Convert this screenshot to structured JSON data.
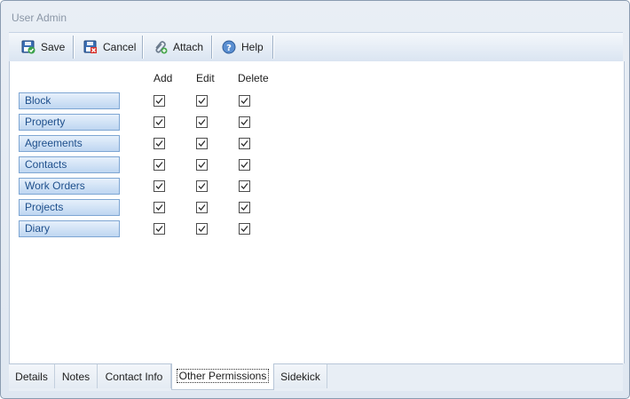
{
  "window": {
    "title": "User Admin"
  },
  "toolbar": {
    "save_label": "Save",
    "cancel_label": "Cancel",
    "attach_label": "Attach",
    "help_label": "Help"
  },
  "permissions": {
    "columns": [
      "Add",
      "Edit",
      "Delete"
    ],
    "rows": [
      {
        "label": "Block",
        "add": true,
        "edit": true,
        "delete": true
      },
      {
        "label": "Property",
        "add": true,
        "edit": true,
        "delete": true
      },
      {
        "label": "Agreements",
        "add": true,
        "edit": true,
        "delete": true
      },
      {
        "label": "Contacts",
        "add": true,
        "edit": true,
        "delete": true
      },
      {
        "label": "Work Orders",
        "add": true,
        "edit": true,
        "delete": true
      },
      {
        "label": "Projects",
        "add": true,
        "edit": true,
        "delete": true
      },
      {
        "label": "Diary",
        "add": true,
        "edit": true,
        "delete": true
      }
    ]
  },
  "tabs": [
    {
      "label": "Details",
      "active": false
    },
    {
      "label": "Notes",
      "active": false
    },
    {
      "label": "Contact Info",
      "active": false
    },
    {
      "label": "Other Permissions",
      "active": true
    },
    {
      "label": "Sidekick",
      "active": false
    }
  ],
  "icons": {
    "save": "save-disk-icon",
    "cancel": "cancel-disk-icon",
    "attach": "paperclip-icon",
    "help": "help-icon"
  }
}
